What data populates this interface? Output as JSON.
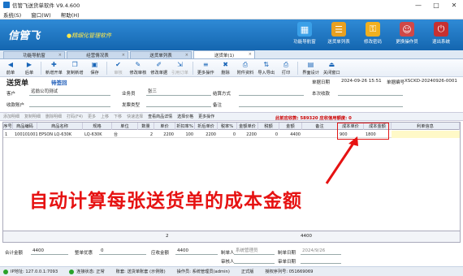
{
  "window": {
    "title": "信管飞送货单软件 V9.4.600",
    "minimize": "—",
    "maximize": "□",
    "close": "✕"
  },
  "menu": [
    "系统(S)",
    "窗口(W)",
    "帮助(H)"
  ],
  "banner": {
    "logo": "信管飞",
    "slogan": "●精细化管理软件",
    "buttons": [
      {
        "label": "功能导航窗",
        "icon": "grid-icon",
        "glyph": "▦",
        "color": "#3aa0e8"
      },
      {
        "label": "送货单列表",
        "icon": "list-icon",
        "glyph": "☰",
        "color": "#e8a020"
      },
      {
        "label": "修改密码",
        "icon": "lock-icon",
        "glyph": "⚿",
        "color": "#f0b020"
      },
      {
        "label": "更换操作员",
        "icon": "user-icon",
        "glyph": "☺",
        "color": "#d04848"
      },
      {
        "label": "退出系统",
        "icon": "power-icon",
        "glyph": "⏻",
        "color": "#c83030"
      }
    ]
  },
  "tabs": [
    {
      "label": "功能导航窗",
      "active": false
    },
    {
      "label": "经营情况表",
      "active": false
    },
    {
      "label": "送货单列表",
      "active": false
    },
    {
      "label": "送货单(1)",
      "active": true
    }
  ],
  "toolbar": [
    {
      "label": "前单",
      "glyph": "◀",
      "disabled": false
    },
    {
      "label": "后单",
      "glyph": "▶",
      "disabled": false
    },
    {
      "label": "新增开单",
      "glyph": "✚",
      "disabled": false
    },
    {
      "label": "复制新增",
      "glyph": "❐",
      "disabled": false
    },
    {
      "label": "保存",
      "glyph": "▣",
      "disabled": false
    },
    {
      "label": "审核",
      "glyph": "✔",
      "disabled": true
    },
    {
      "label": "修改审核",
      "glyph": "✎",
      "disabled": false
    },
    {
      "label": "修改单据",
      "glyph": "✐",
      "disabled": false
    },
    {
      "label": "引用订单",
      "glyph": "⇲",
      "disabled": true
    },
    {
      "label": "更多操作",
      "glyph": "≡",
      "disabled": false
    },
    {
      "label": "删除",
      "glyph": "✖",
      "disabled": false
    },
    {
      "label": "附件资料",
      "glyph": "⎙",
      "disabled": false
    },
    {
      "label": "导入导出",
      "glyph": "⇅",
      "disabled": false
    },
    {
      "label": "打印",
      "glyph": "⎙",
      "disabled": false
    },
    {
      "label": "界面设计",
      "glyph": "▤",
      "disabled": false
    },
    {
      "label": "关闭窗口",
      "glyph": "⏏",
      "disabled": false
    }
  ],
  "doc": {
    "title": "送货单",
    "status": "待签回",
    "date_label": "单据日期",
    "date": "2024-09-26 15:51",
    "no_label": "单据编号",
    "no": "XSCKD-20240926-0001"
  },
  "form": {
    "customer_label": "客户",
    "customer": "远翁公司测试",
    "salesman_label": "业务员",
    "salesman": "张三",
    "settle_label": "结算方式",
    "settle": "",
    "received_label": "本次收款",
    "received": "",
    "account_label": "收款账户",
    "account": "",
    "invoice_label": "发票类型",
    "invoice": "",
    "remark_label": "备注",
    "remark": ""
  },
  "gridbar": {
    "buttons": [
      {
        "label": "添加明细",
        "on": false
      },
      {
        "label": "复制明细",
        "on": false
      },
      {
        "label": "删除明细",
        "on": false
      },
      {
        "label": "打码(F4)",
        "on": false
      },
      {
        "label": "更多",
        "on": false
      },
      {
        "label": "上移",
        "on": false
      },
      {
        "label": "下移",
        "on": false
      },
      {
        "label": "快速选择",
        "on": false
      },
      {
        "label": "查看商品详情",
        "on": true
      },
      {
        "label": "选择价格",
        "on": true
      },
      {
        "label": "更多操作",
        "on": true
      }
    ],
    "stats": "此前应收款: 589320   应收信用额度: 0"
  },
  "grid": {
    "columns": [
      "序号",
      "商品编码",
      "商品名称",
      "规格",
      "单位",
      "数量",
      "单价",
      "折扣率%",
      "折后单价",
      "税率%",
      "金额单价",
      "税额",
      "金额",
      "备注",
      "成本单价",
      "成本金额",
      "利单信息"
    ],
    "rows": [
      [
        "1",
        "100101001",
        "EPSON LQ-630K",
        "LQ-630K",
        "台",
        "2",
        "2200",
        "100",
        "2200",
        "0",
        "2200",
        "0",
        "4400",
        "",
        "900",
        "1800",
        ""
      ]
    ],
    "footer_qty": "2",
    "footer_amount": "4400"
  },
  "callout": "自动计算每张送货单的成本金额",
  "bottom": {
    "total_label": "合计金额",
    "total": "4400",
    "discount_label": "整单优惠",
    "discount": "0",
    "receivable_label": "应收金额",
    "receivable": "4400",
    "maker_label": "制单人",
    "maker": "系统管理员",
    "audit_label": "审核人",
    "audit": "",
    "make_date_label": "制单日期",
    "make_date": "2024/9/26",
    "audit_date_label": "审单日期",
    "audit_date": ""
  },
  "statusbar": {
    "items": [
      "IP地址: 127.0.0.1:7093",
      "连接状态: 正常",
      "账套: 送货单账套 (示例账)",
      "操作员: 系统管理员(admin)",
      "正式版",
      "授权序列号: 051669069"
    ]
  }
}
